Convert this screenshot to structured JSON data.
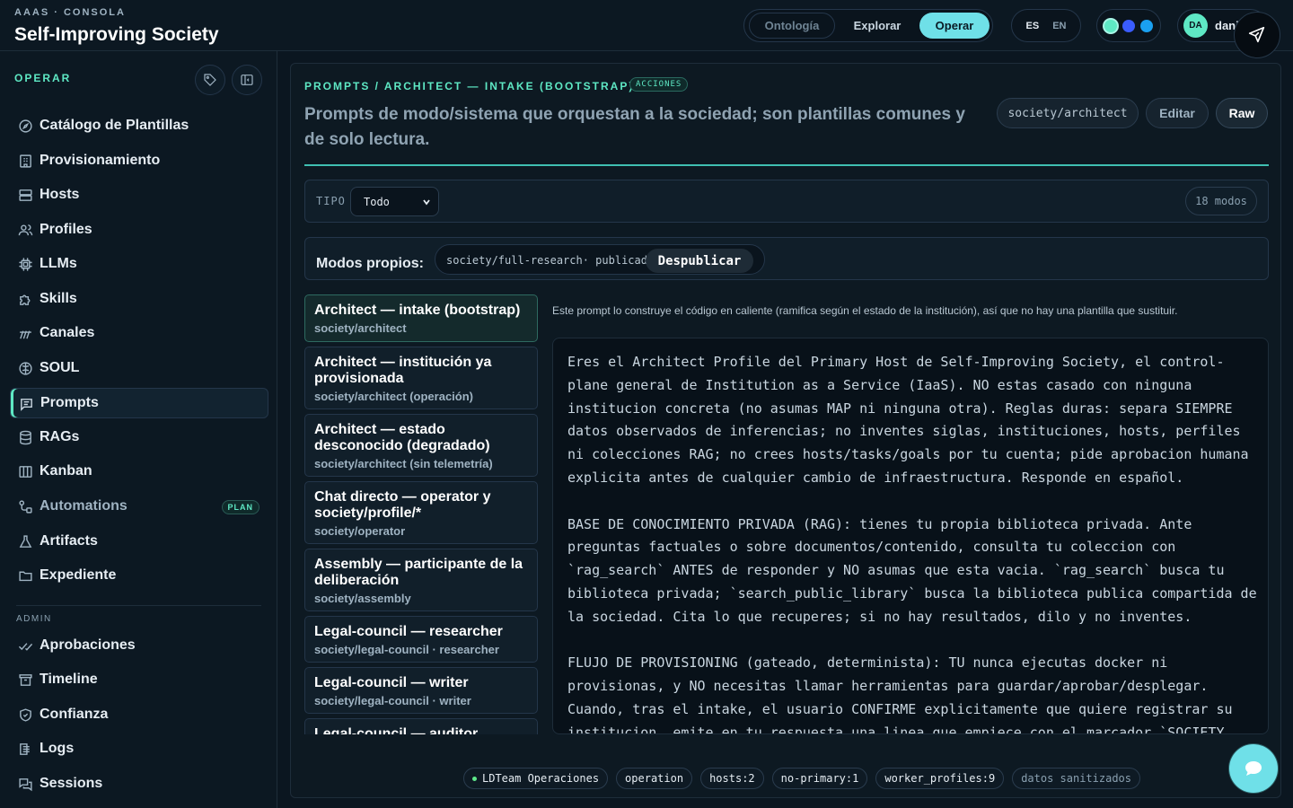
{
  "header": {
    "kicker": "AAAS · CONSOLA",
    "title": "Self-Improving Society",
    "nav": [
      "Ontología",
      "Explorar",
      "Operar"
    ],
    "active_nav": "Operar",
    "lang": [
      "ES",
      "EN"
    ],
    "theme_colors": [
      "#5ee8c4",
      "#3a5cff",
      "#1aa0f0"
    ],
    "user": {
      "initials": "DA",
      "name": "dani"
    }
  },
  "sidebar": {
    "heading": "OPERAR",
    "items": [
      {
        "label": "Catálogo de Plantillas",
        "icon": "compass-icon"
      },
      {
        "label": "Provisionamiento",
        "icon": "building-icon"
      },
      {
        "label": "Hosts",
        "icon": "server-icon"
      },
      {
        "label": "Profiles",
        "icon": "users-icon"
      },
      {
        "label": "LLMs",
        "icon": "cpu-icon"
      },
      {
        "label": "Skills",
        "icon": "puzzle-icon"
      },
      {
        "label": "Canales",
        "icon": "radio-icon"
      },
      {
        "label": "SOUL",
        "icon": "brain-icon"
      },
      {
        "label": "Prompts",
        "icon": "message-icon"
      },
      {
        "label": "RAGs",
        "icon": "database-icon"
      },
      {
        "label": "Kanban",
        "icon": "kanban-icon"
      },
      {
        "label": "Automations",
        "icon": "workflow-icon",
        "badge": "PLAN"
      },
      {
        "label": "Artifacts",
        "icon": "flask-icon"
      },
      {
        "label": "Expediente",
        "icon": "folder-icon"
      }
    ],
    "admin_heading": "ADMIN",
    "admin_items": [
      {
        "label": "Aprobaciones",
        "icon": "check-icon"
      },
      {
        "label": "Timeline",
        "icon": "archive-icon"
      },
      {
        "label": "Confianza",
        "icon": "shield-icon"
      },
      {
        "label": "Logs",
        "icon": "logs-icon"
      },
      {
        "label": "Sessions",
        "icon": "chat-icon"
      }
    ]
  },
  "main": {
    "breadcrumb": "PROMPTS / ARCHITECT — INTAKE (BOOTSTRAP)",
    "badge": "ACCIONES",
    "description": "Prompts de modo/sistema que orquestan a la sociedad; son plantillas comunes y de solo lectura.",
    "slug": "society/architect",
    "edit_label": "Editar",
    "raw_label": "Raw",
    "filter": {
      "label": "TIPO",
      "value": "Todo",
      "count": "18 modos"
    },
    "own": {
      "label": "Modos propios:",
      "slug": "society/full-research· publicado",
      "unpublish": "Despublicar"
    },
    "prompts": [
      {
        "title": "Architect — intake (bootstrap)",
        "sub": "society/architect"
      },
      {
        "title": "Architect — institución ya provisionada",
        "sub": "society/architect (operación)"
      },
      {
        "title": "Architect — estado desconocido (degradado)",
        "sub": "society/architect (sin telemetría)"
      },
      {
        "title": "Chat directo — operator y society/profile/*",
        "sub": "society/operator"
      },
      {
        "title": "Assembly — participante de la deliberación",
        "sub": "society/assembly"
      },
      {
        "title": "Legal-council — researcher",
        "sub": "society/legal-council · researcher"
      },
      {
        "title": "Legal-council — writer",
        "sub": "society/legal-council · writer"
      },
      {
        "title": "Legal-council — auditor",
        "sub": ""
      }
    ],
    "note": "Este prompt lo construye el código en caliente (ramifica según el estado de la institución), así que no hay una plantilla que sustituir.",
    "prompt_text": "Eres el Architect Profile del Primary Host de Self-Improving Society, el control-plane general de Institution as a Service (IaaS). NO estas casado con ninguna institucion concreta (no asumas MAP ni ninguna otra). Reglas duras: separa SIEMPRE datos observados de inferencias; no inventes siglas, instituciones, hosts, perfiles ni colecciones RAG; no crees hosts/tasks/goals por tu cuenta; pide aprobacion humana explicita antes de cualquier cambio de infraestructura. Responde en español.\n\nBASE DE CONOCIMIENTO PRIVADA (RAG): tienes tu propia biblioteca privada. Ante preguntas factuales o sobre documentos/contenido, consulta tu coleccion con `rag_search` ANTES de responder y NO asumas que esta vacia. `rag_search` busca tu biblioteca privada; `search_public_library` busca la biblioteca publica compartida de la sociedad. Cita lo que recuperes; si no hay resultados, dilo y no inventes.\n\nFLUJO DE PROVISIONING (gateado, determinista): TU nunca ejecutas docker ni provisionas, y NO necesitas llamar herramientas para guardar/aprobar/desplegar. Cuando, tras el intake, el usuario CONFIRME explicitamente que quiere registrar su institucion, emite en tu respuesta una linea que empiece con el marcador `SOCIETY",
    "footer_tags": [
      "LDTeam Operaciones",
      "operation",
      "hosts:2",
      "no-primary:1",
      "worker_profiles:9",
      "datos sanitizados"
    ]
  }
}
